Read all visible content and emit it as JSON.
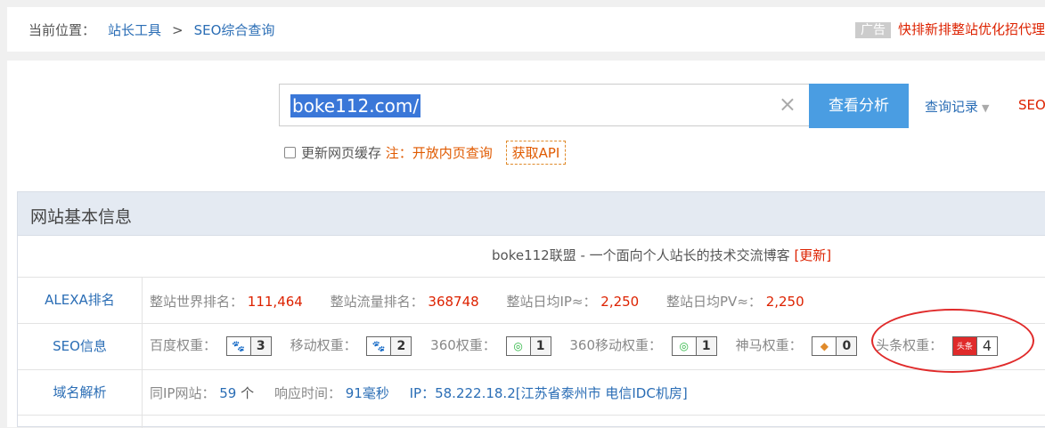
{
  "breadcrumb": {
    "prefix": "当前位置：",
    "item1": "站长工具",
    "sep": ">",
    "item2": "SEO综合查询"
  },
  "ad": {
    "tag": "广告",
    "text": "快排新排整站优化招代理"
  },
  "search": {
    "value": "boke112.com/",
    "clear_icon": "×",
    "button": "查看分析",
    "history": "查询记录",
    "history_arrow": "▼",
    "seo_link": "SEO"
  },
  "options": {
    "refresh_label": "更新网页缓存",
    "note": "注：开放内页查询",
    "api": "获取API"
  },
  "panel": {
    "title": "网站基本信息",
    "site_title": "boke112联盟 - 一个面向个人站长的技术交流博客",
    "site_title_new": "[更新]",
    "alexa": {
      "label": "ALEXA排名",
      "world_label": "整站世界排名：",
      "world": "111,464",
      "traffic_label": "整站流量排名：",
      "traffic": "368748",
      "ip_label": "整站日均IP≈：",
      "ip": "2,250",
      "pv_label": "整站日均PV≈：",
      "pv": "2,250"
    },
    "seo": {
      "label": "SEO信息",
      "baidu_label": "百度权重：",
      "baidu": "3",
      "mobile_label": "移动权重：",
      "mobile": "2",
      "s360_label": "360权重：",
      "s360": "1",
      "s360m_label": "360移动权重：",
      "s360m": "1",
      "shenma_label": "神马权重：",
      "shenma": "0",
      "toutiao_label": "头条权重：",
      "toutiao": "4",
      "toutiao_icon_text": "头条"
    },
    "dns": {
      "label": "域名解析",
      "sameip_label": "同IP网站：",
      "sameip": "59",
      "sameip_unit": "个",
      "resp_label": "响应时间：",
      "resp": "91毫秒",
      "ip_label": "IP：",
      "ip": "58.222.18.2[江苏省泰州市 电信IDC机房]"
    }
  }
}
